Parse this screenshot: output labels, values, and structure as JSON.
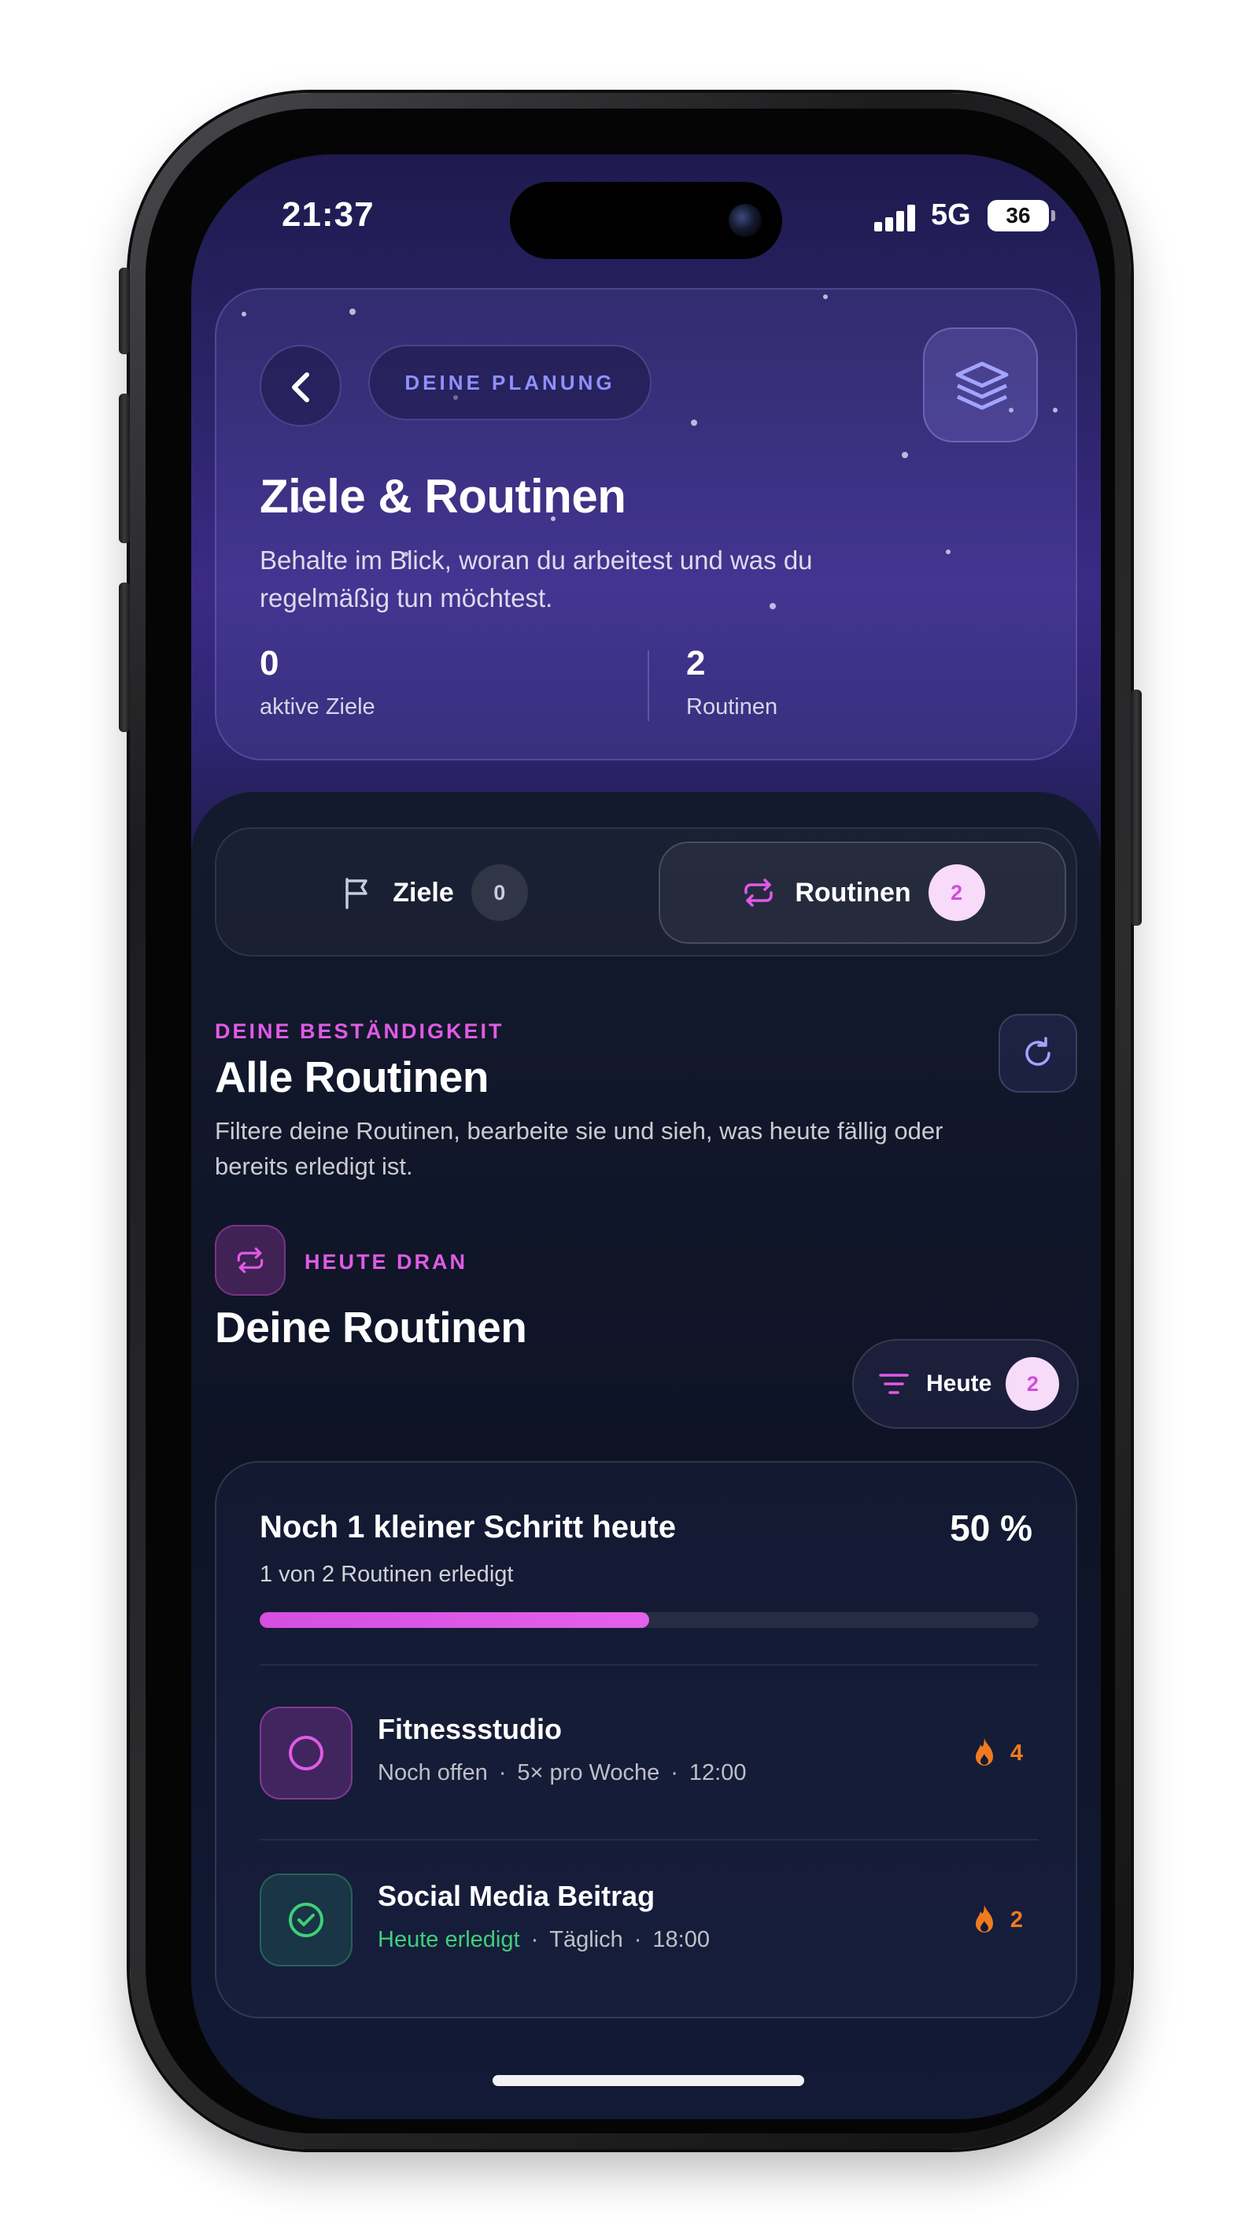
{
  "status_bar": {
    "time": "21:37",
    "network": "5G",
    "battery": "36"
  },
  "header": {
    "pill": "DEINE PLANUNG",
    "title": "Ziele & Routinen",
    "subtitle": "Behalte im Blick, woran du arbeitest und was du regelmäßig tun möchtest.",
    "stats": [
      {
        "value": "0",
        "label": "aktive Ziele"
      },
      {
        "value": "2",
        "label": "Routinen"
      }
    ]
  },
  "tabs": [
    {
      "label": "Ziele",
      "count": "0",
      "icon": "flag-icon",
      "active": false
    },
    {
      "label": "Routinen",
      "count": "2",
      "icon": "repeat-icon",
      "active": true
    }
  ],
  "section": {
    "eyebrow": "DEINE BESTÄNDIGKEIT",
    "title": "Alle Routinen",
    "subtitle": "Filtere deine Routinen, bearbeite sie und sieh, was heute fällig oder bereits erledigt ist."
  },
  "routines_block": {
    "eyebrow": "HEUTE DRAN",
    "title": "Deine Routinen",
    "filter": {
      "label": "Heute",
      "count": "2"
    }
  },
  "progress": {
    "title": "Noch 1 kleiner Schritt heute",
    "percent_label": "50 %",
    "subtitle": "1 von 2 Routinen erledigt",
    "fraction": 0.5
  },
  "routines": [
    {
      "name": "Fitnessstudio",
      "status": "Noch offen",
      "frequency": "5× pro Woche",
      "time": "12:00",
      "streak": "4",
      "done": false
    },
    {
      "name": "Social Media Beitrag",
      "status": "Heute erledigt",
      "frequency": "Täglich",
      "time": "18:00",
      "streak": "2",
      "done": true
    }
  ],
  "colors": {
    "accent_pink": "#e05ae6",
    "accent_purple": "#8f90ff",
    "success_green": "#3fcf7a",
    "streak_orange": "#f07a1f"
  }
}
